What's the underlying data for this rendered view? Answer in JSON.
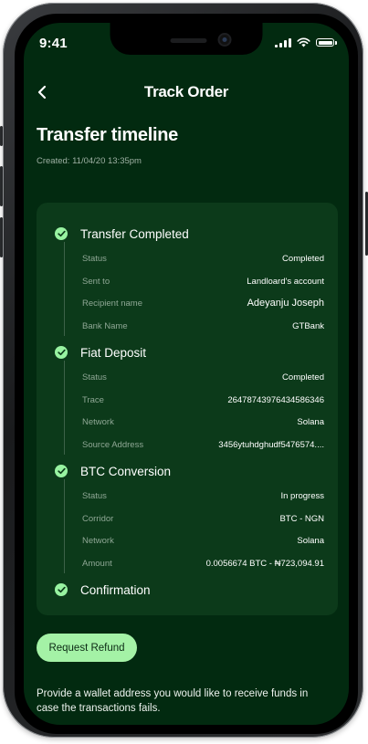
{
  "status_bar": {
    "time": "9:41"
  },
  "nav": {
    "title": "Track Order"
  },
  "header": {
    "title": "Transfer timeline",
    "created": "Created: 11/04/20 13:35pm"
  },
  "timeline": [
    {
      "label": "Transfer Completed",
      "rows": [
        {
          "key": "Status",
          "value": "Completed"
        },
        {
          "key": "Sent to",
          "value": "Landloard's account"
        },
        {
          "key": "Recipient name",
          "value": "Adeyanju Joseph"
        },
        {
          "key": "Bank Name",
          "value": "GTBank"
        }
      ]
    },
    {
      "label": "Fiat Deposit",
      "rows": [
        {
          "key": "Status",
          "value": "Completed"
        },
        {
          "key": "Trace",
          "value": "26478743976434586346"
        },
        {
          "key": "Network",
          "value": "Solana"
        },
        {
          "key": "Source Address",
          "value": "3456ytuhdghudf5476574...."
        }
      ]
    },
    {
      "label": "BTC Conversion",
      "rows": [
        {
          "key": "Status",
          "value": "In progress"
        },
        {
          "key": "Corridor",
          "value": "BTC - NGN"
        },
        {
          "key": "Network",
          "value": "Solana"
        },
        {
          "key": "Amount",
          "value": "0.0056674 BTC - ₦723,094.91"
        }
      ]
    },
    {
      "label": "Confirmation",
      "rows": []
    }
  ],
  "actions": {
    "refund_label": "Request Refund",
    "note": "Provide a wallet address you would like to receive funds in case the transactions fails."
  },
  "icons": {
    "back": "chevron-left-icon",
    "check": "check-circle-icon",
    "signal": "cellular-signal-icon",
    "wifi": "wifi-icon",
    "battery": "battery-icon"
  },
  "colors": {
    "background": "#022a10",
    "card": "#0c3a1a",
    "accent": "#98f3a1",
    "button": "#a4f2a6"
  }
}
